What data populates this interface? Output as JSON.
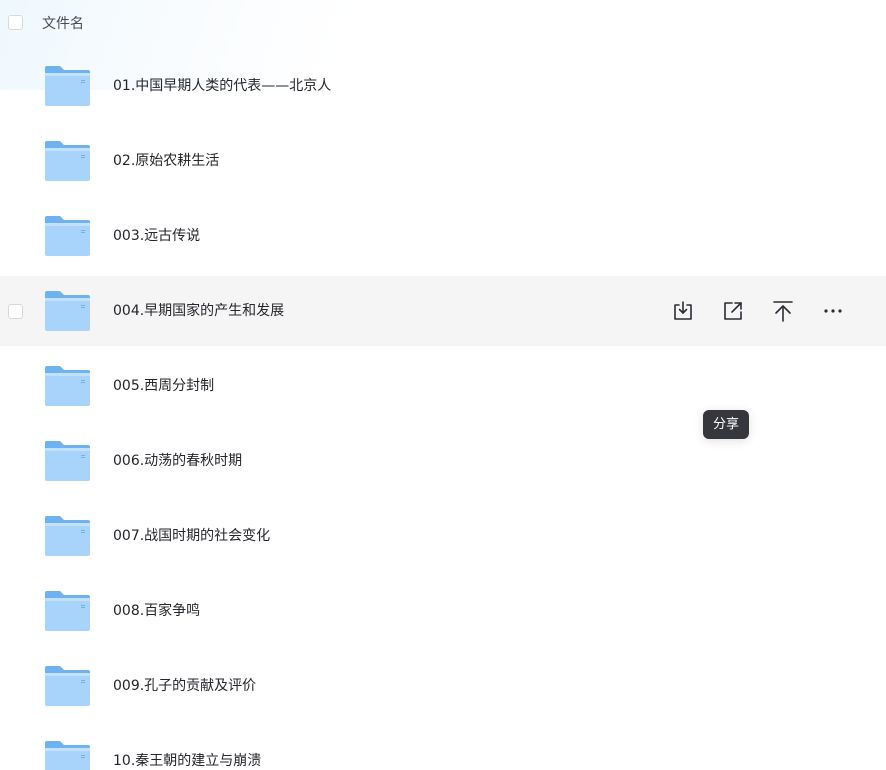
{
  "header": {
    "column_label": "文件名"
  },
  "files": [
    {
      "name": "01.中国早期人类的代表——北京人",
      "type": "folder"
    },
    {
      "name": "02.原始农耕生活",
      "type": "folder"
    },
    {
      "name": "003.远古传说",
      "type": "folder"
    },
    {
      "name": "004.早期国家的产生和发展",
      "type": "folder",
      "hovered": true
    },
    {
      "name": "005.西周分封制",
      "type": "folder"
    },
    {
      "name": "006.动荡的春秋时期",
      "type": "folder"
    },
    {
      "name": "007.战国时期的社会变化",
      "type": "folder"
    },
    {
      "name": "008.百家争鸣",
      "type": "folder"
    },
    {
      "name": "009.孔子的贡献及评价",
      "type": "folder"
    },
    {
      "name": "10.秦王朝的建立与崩溃",
      "type": "folder"
    }
  ],
  "row_actions": [
    {
      "name": "download",
      "icon": "download-icon"
    },
    {
      "name": "share",
      "icon": "share-icon"
    },
    {
      "name": "move-to-top",
      "icon": "move-top-icon"
    },
    {
      "name": "more",
      "icon": "more-icon"
    }
  ],
  "tooltip": {
    "text": "分享"
  },
  "colors": {
    "folder_light": "#a8d4fb",
    "folder_dark": "#6eb3f0",
    "hover_row": "#f5f5f6",
    "tooltip_bg": "#35373c"
  }
}
